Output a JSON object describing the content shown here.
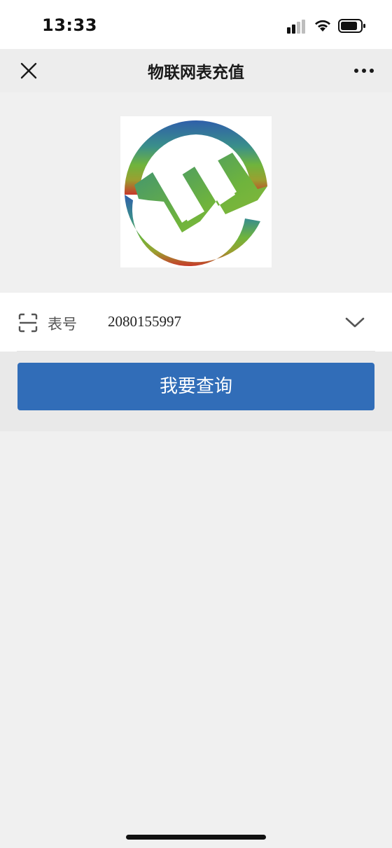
{
  "status_bar": {
    "time": "13:33"
  },
  "nav": {
    "title": "物联网表充值",
    "close_icon": "close-icon",
    "more_icon": "more-dots-icon"
  },
  "logo": {
    "icon": "company-logo"
  },
  "meter": {
    "label": "表号",
    "value": "2080155997",
    "scan_icon": "scan-icon",
    "dropdown_icon": "chevron-down-icon"
  },
  "query_button": {
    "label": "我要查询"
  },
  "colors": {
    "accent": "#316db8",
    "background": "#f0f0f0",
    "nav_background": "#ededed"
  }
}
